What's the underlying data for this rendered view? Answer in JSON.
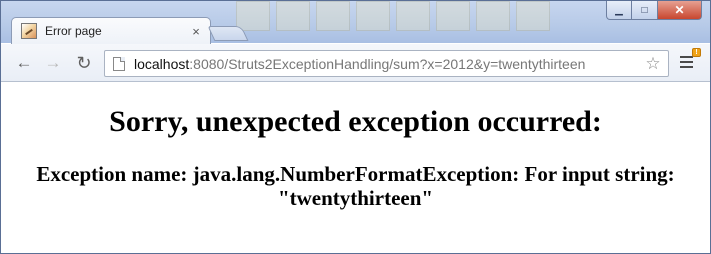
{
  "browser": {
    "tab": {
      "title": "Error page"
    },
    "address_bar": {
      "url_scheme_host": "localhost",
      "url_rest": ":8080/Struts2ExceptionHandling/sum?x=2012&y=twentythirteen"
    },
    "icons": {
      "tab_close": "×",
      "back": "←",
      "forward": "→",
      "reload": "↻",
      "bookmark": "☆",
      "minimize": "▁",
      "maximize": "□",
      "close": "✕",
      "update_badge": "!"
    }
  },
  "page": {
    "heading": "Sorry, unexpected exception occurred:",
    "exception_line": "Exception name: java.lang.NumberFormatException: For input string: \"twentythirteen\""
  }
}
